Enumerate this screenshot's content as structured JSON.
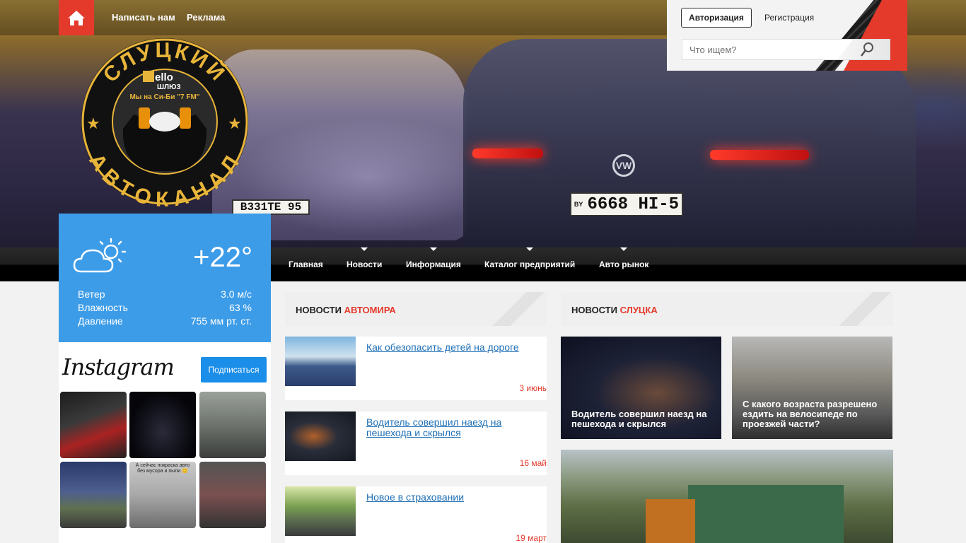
{
  "topnav": {
    "links": [
      "Написать нам",
      "Реклама"
    ]
  },
  "logo": {
    "top_text": "СЛУЦКИЙ",
    "bottom_text": "АВТОКАНАЛ",
    "brand": "ello",
    "brand_sub": "ШЛЮЗ",
    "tagline": "Мы на Си-Би \"7 FM\""
  },
  "hero": {
    "plate_main": "6668 HI-5",
    "plate_main_country": "BY",
    "plate_left": "B331TE 95"
  },
  "auth": {
    "login_label": "Авторизация",
    "register_label": "Регистрация",
    "search_placeholder": "Что ищем?"
  },
  "mainnav": {
    "items": [
      "Главная",
      "Новости",
      "Информация",
      "Каталог предприятий",
      "Авто рынок"
    ]
  },
  "weather": {
    "temperature": "+22°",
    "rows": [
      {
        "label": "Ветер",
        "value": "3.0 м/с"
      },
      {
        "label": "Влажность",
        "value": "63 %"
      },
      {
        "label": "Давление",
        "value": "755 мм рт. ст."
      }
    ]
  },
  "instagram": {
    "title": "Instagram",
    "subscribe_label": "Подписаться",
    "thumb_captions": [
      "А сейчас покраска авто без мусора и пыли 😊",
      "",
      ""
    ]
  },
  "auto_news": {
    "heading_black": "НОВОСТИ ",
    "heading_red": "АВТОМИРА",
    "items": [
      {
        "title": "Как обезопасить детей на дороге",
        "date": "3 июнь"
      },
      {
        "title": "Водитель совершил наезд на пешехода и скрылся",
        "date": "16 май"
      },
      {
        "title": "Новое в страховании",
        "date": "19 март"
      }
    ]
  },
  "slutsk_news": {
    "heading_black": "НОВОСТИ ",
    "heading_red": "СЛУЦКА",
    "tiles": [
      {
        "caption": "Водитель совершил наезд на пешехода и скрылся"
      },
      {
        "caption": "С какого возраста разрешено ездить на велосипеде по проезжей части?"
      }
    ]
  },
  "colors": {
    "accent_red": "#e33a2c",
    "weather_blue": "#3d9ce8",
    "subscribe_blue": "#1a8ee8",
    "link_blue": "#1f6fb5"
  }
}
